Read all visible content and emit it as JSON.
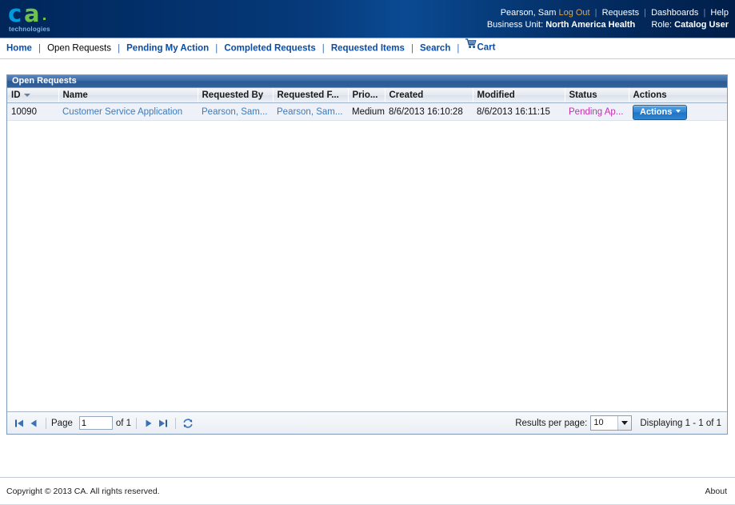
{
  "banner": {
    "logo": {
      "letter_c": "c",
      "letter_a": "a",
      "tagline": "technologies"
    },
    "user_name": "Pearson, Sam",
    "log_out": "Log Out",
    "requests": "Requests",
    "dashboards": "Dashboards",
    "help": "Help",
    "separator": "|",
    "business_unit_label": "Business Unit:",
    "business_unit_value": "North America Health",
    "role_label": "Role:",
    "role_value": "Catalog User"
  },
  "nav": {
    "separator": "|",
    "items": [
      {
        "label": "Home",
        "active": false
      },
      {
        "label": "Open Requests",
        "active": true
      },
      {
        "label": "Pending My Action",
        "active": false
      },
      {
        "label": "Completed Requests",
        "active": false
      },
      {
        "label": "Requested Items",
        "active": false
      },
      {
        "label": "Search",
        "active": false
      }
    ],
    "cart_label": "Cart",
    "cart_icon": "shopping-cart-icon"
  },
  "panel": {
    "title": "Open Requests",
    "columns": [
      {
        "label": "ID",
        "sorted": "desc"
      },
      {
        "label": "Name"
      },
      {
        "label": "Requested By"
      },
      {
        "label": "Requested F..."
      },
      {
        "label": "Prio..."
      },
      {
        "label": "Created"
      },
      {
        "label": "Modified"
      },
      {
        "label": "Status"
      },
      {
        "label": "Actions"
      }
    ],
    "rows": [
      {
        "id": "10090",
        "name": "Customer Service Application",
        "requested_by": "Pearson, Sam...",
        "requested_for": "Pearson, Sam...",
        "priority": "Medium",
        "created": "8/6/2013 16:10:28",
        "modified": "8/6/2013 16:11:15",
        "status": "Pending Ap...",
        "action_button": "Actions"
      }
    ]
  },
  "pager": {
    "first_icon": "first-page-icon",
    "prev_icon": "previous-page-icon",
    "page_label": "Page",
    "page_value": "1",
    "of_label": "of 1",
    "next_icon": "next-page-icon",
    "last_icon": "last-page-icon",
    "refresh_icon": "refresh-icon",
    "results_per_page_label": "Results per page:",
    "results_per_page_value": "10",
    "displaying": "Displaying 1 - 1 of 1"
  },
  "footer": {
    "copyright": "Copyright © 2013 CA. All rights reserved.",
    "about": "About"
  },
  "colors": {
    "banner_blue": "#002d62",
    "link_blue": "#0c4da2",
    "logout_gold": "#e8a33d",
    "status_magenta": "#c22fae",
    "logo_cyan": "#009ade",
    "logo_green": "#6ec04f",
    "button_blue": "#2f86d4"
  }
}
